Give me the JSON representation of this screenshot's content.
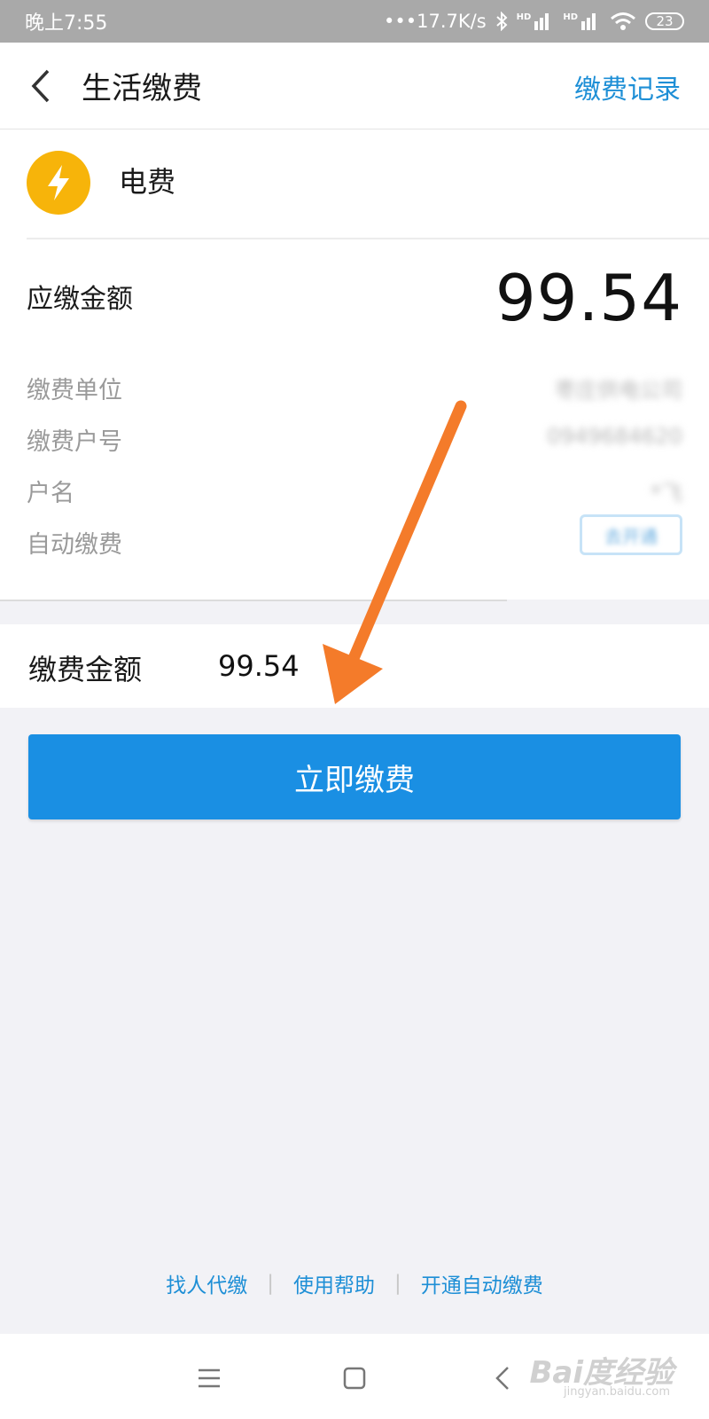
{
  "status_bar": {
    "time": "晚上7:55",
    "network_speed": "•••17.7K/s",
    "sim1_label": "HD",
    "sim2_label": "HD",
    "battery": "23"
  },
  "nav": {
    "title": "生活缴费",
    "records_link": "缴费记录"
  },
  "bill": {
    "type": "电费",
    "due_label": "应缴金额",
    "due_amount": "99.54",
    "info": [
      {
        "label": "缴费单位",
        "value": "枣庄供电公司"
      },
      {
        "label": "缴费户号",
        "value": "0949684620"
      },
      {
        "label": "户名",
        "value": "*飞"
      },
      {
        "label": "自动缴费",
        "value": "去开通"
      }
    ]
  },
  "payment": {
    "amount_label": "缴费金额",
    "amount_value": "99.54",
    "pay_button": "立即缴费"
  },
  "footer": {
    "links": [
      "找人代缴",
      "使用帮助",
      "开通自动缴费"
    ]
  },
  "watermark": {
    "text": "Bai度经验",
    "sub": "jingyan.baidu.com"
  },
  "colors": {
    "accent": "#1a8fe3",
    "link": "#1e8fd6",
    "bill_icon": "#f7b40a",
    "annotation_arrow": "#f47b2a"
  },
  "icons": {
    "back": "chevron-left-icon",
    "bill": "lightning-icon",
    "bluetooth": "bluetooth-icon",
    "wifi": "wifi-icon"
  }
}
